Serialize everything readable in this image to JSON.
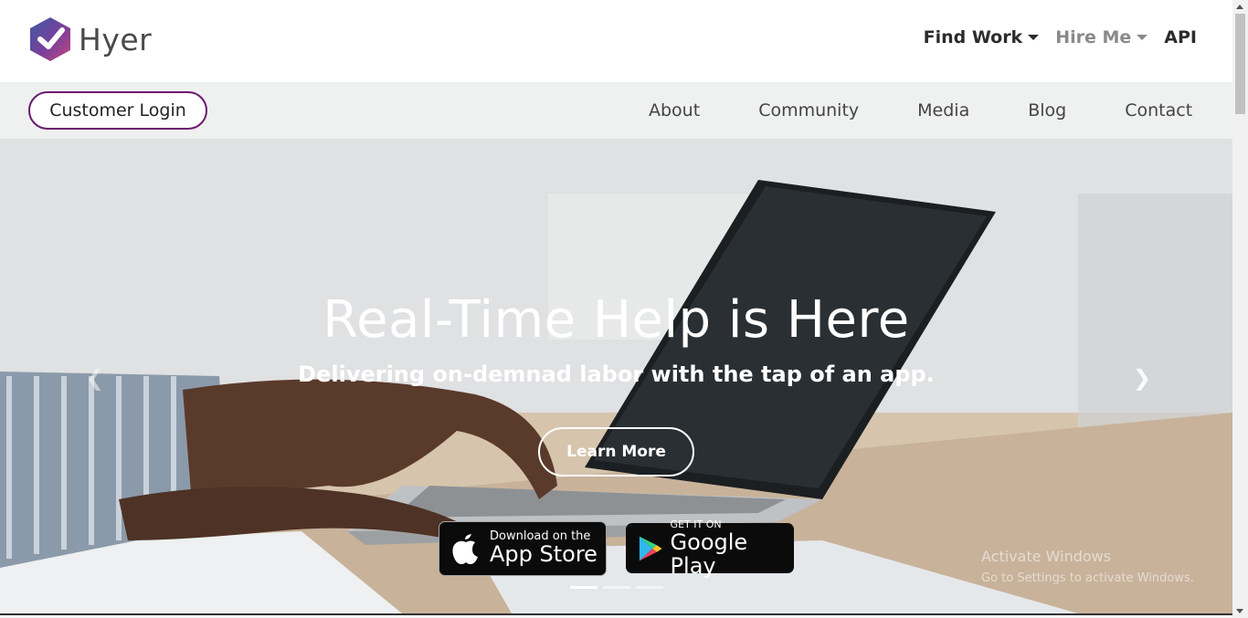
{
  "brand": {
    "name": "Hyer",
    "logo_colors": [
      "#3b5ba5",
      "#7a3f9a",
      "#c2477e"
    ]
  },
  "topnav": {
    "find_work": "Find Work",
    "hire_me": "Hire Me",
    "api": "API"
  },
  "subbar": {
    "login": "Customer Login",
    "links": [
      "About",
      "Community",
      "Media",
      "Blog",
      "Contact"
    ]
  },
  "hero": {
    "title": "Real-Time Help is Here",
    "subtitle": "Delivering on-demnad labor with the tap of an app.",
    "cta": "Learn More",
    "prev_icon": "chevron-left-icon",
    "next_icon": "chevron-right-icon",
    "app_store": {
      "small": "Download on the",
      "big": "App Store"
    },
    "google_play": {
      "small": "GET IT ON",
      "big": "Google Play"
    },
    "slides": 3,
    "active_slide": 1
  },
  "watermark": {
    "line1": "Activate Windows",
    "line2": "Go to Settings to activate Windows."
  }
}
